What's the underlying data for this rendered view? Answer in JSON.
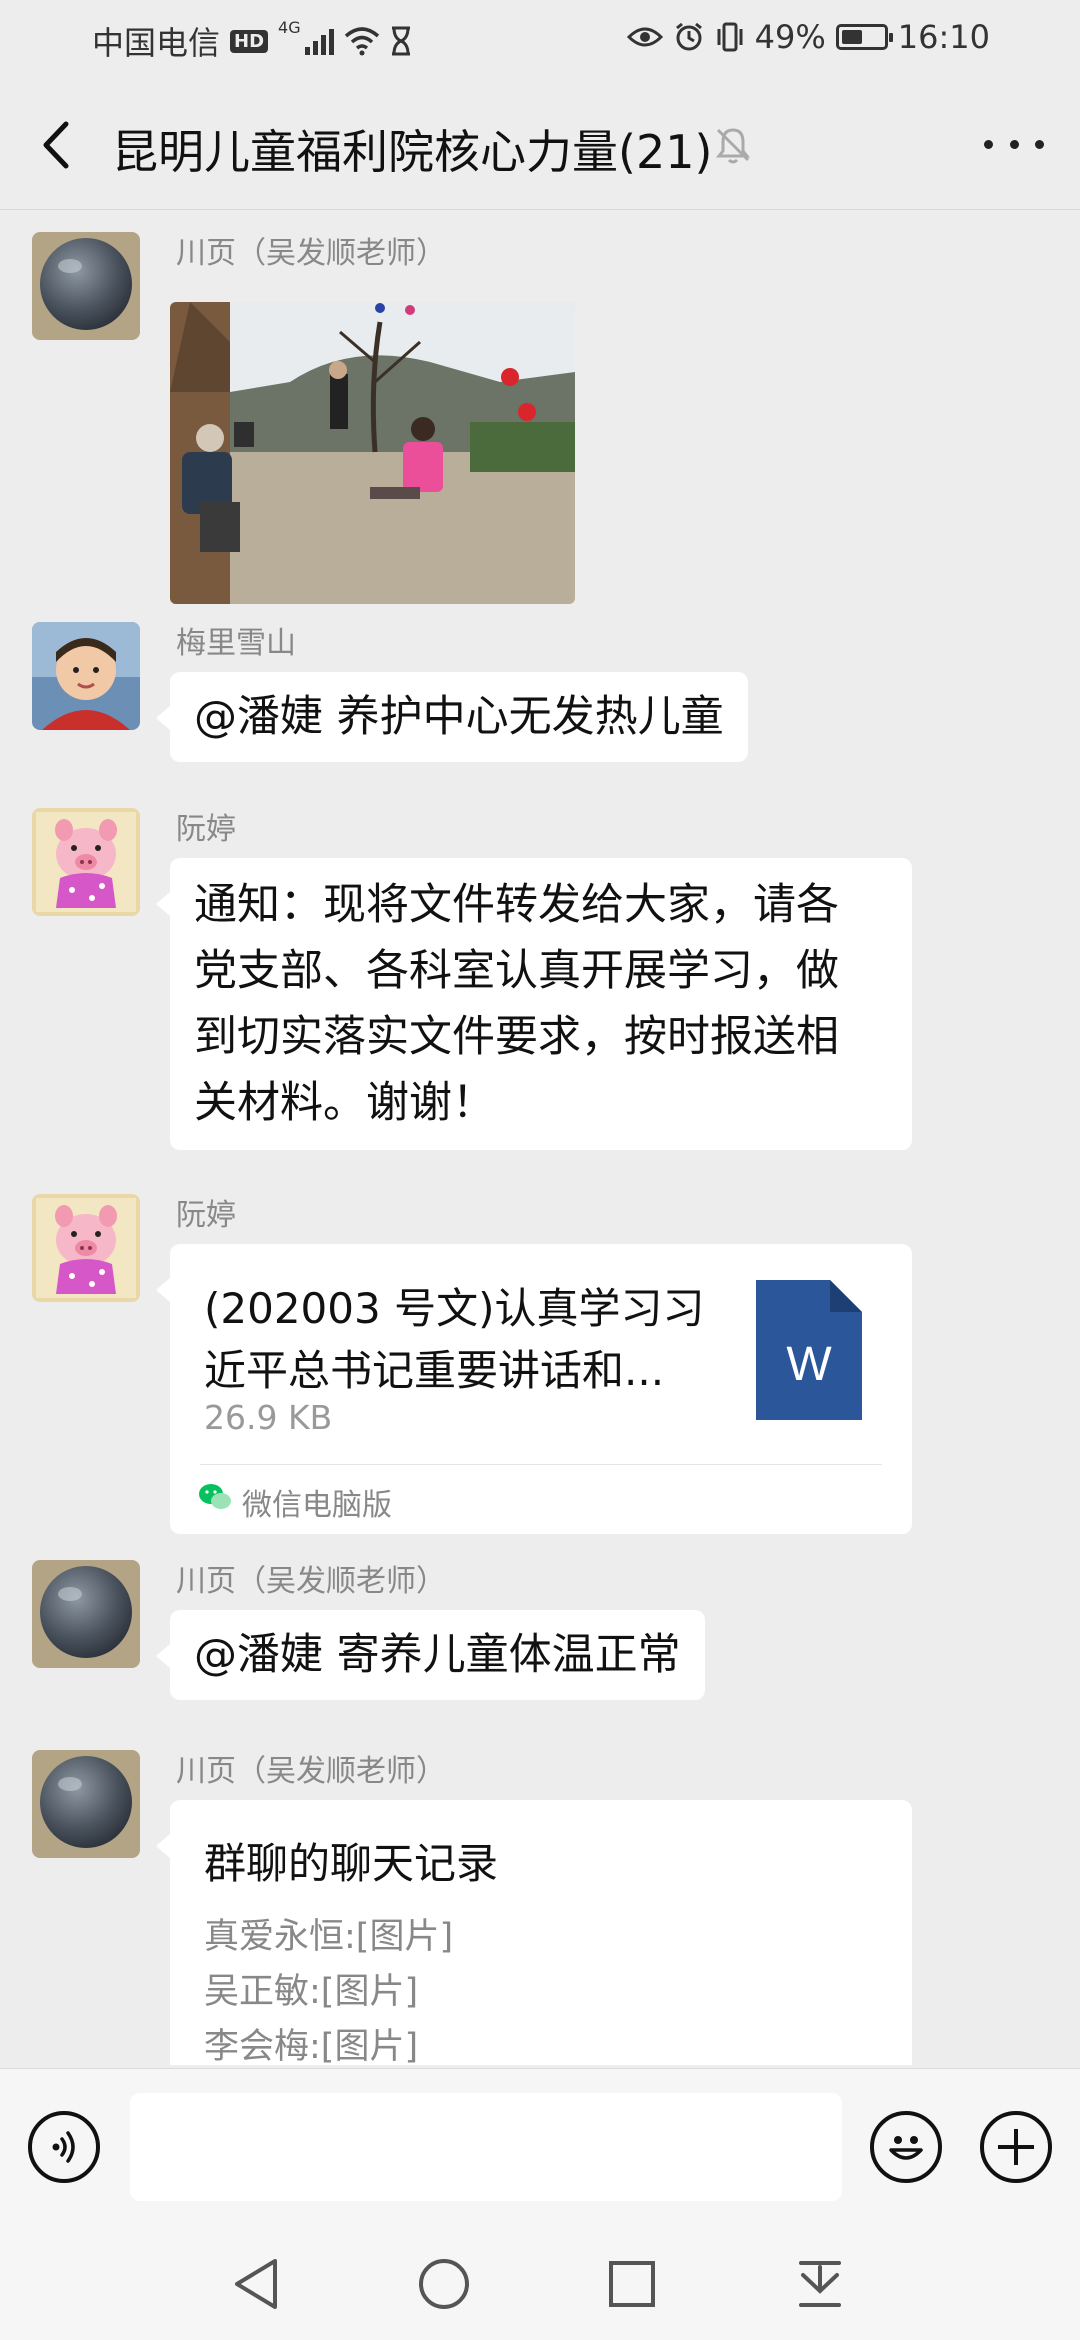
{
  "status_bar": {
    "carrier": "中国电信",
    "hd": "HD",
    "network": "4G",
    "battery_percent": "49%",
    "battery_level": 0.49,
    "time": "16:10"
  },
  "header": {
    "title": "昆明儿童福利院核心力量(21)"
  },
  "messages": [
    {
      "sender": "川页（吴发顺老师）",
      "type": "image"
    },
    {
      "sender": "梅里雪山",
      "type": "text",
      "text": "@潘婕  养护中心无发热儿童"
    },
    {
      "sender": "阮婷",
      "type": "text",
      "lines": [
        "通知：现将文件转发给大家，请各",
        "党支部、各科室认真开展学习，做",
        "到切实落实文件要求，按时报送相",
        "关材料。谢谢！"
      ]
    },
    {
      "sender": "阮婷",
      "type": "file",
      "title_lines": [
        "(202003 号文)认真学习习",
        "近平总书记重要讲话和..."
      ],
      "size": "26.9 KB",
      "file_icon_letter": "W",
      "source": "微信电脑版"
    },
    {
      "sender": "川页（吴发顺老师）",
      "type": "text",
      "text": "@潘婕 寄养儿童体温正常"
    },
    {
      "sender": "川页（吴发顺老师）",
      "type": "chat_record",
      "title": "群聊的聊天记录",
      "lines": [
        "真爱永恒:[图片]",
        "吴正敏:[图片]",
        "李会梅:[图片]"
      ]
    }
  ],
  "input": {
    "value": "",
    "placeholder": ""
  },
  "colors": {
    "background": "#ededed",
    "bubble": "#ffffff",
    "word_blue": "#2b579a",
    "wechat_green": "#07c160"
  },
  "icons": {
    "back": "chevron-left-icon",
    "mute": "bell-off-icon",
    "more": "more-dots-icon",
    "voice": "voice-icon",
    "emoji": "emoji-icon",
    "add": "plus-icon",
    "nav_back": "triangle-back-icon",
    "nav_home": "circle-home-icon",
    "nav_recent": "square-recent-icon",
    "nav_notif": "pull-down-icon"
  }
}
